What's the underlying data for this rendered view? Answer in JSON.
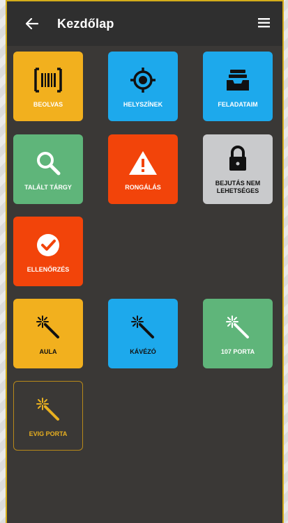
{
  "header": {
    "title": "Kezdőlap"
  },
  "colors": {
    "yellow": "#F2B01E",
    "blue": "#1DA9EC",
    "green": "#5FB57A",
    "red": "#F2440A",
    "grey": "#C9CACC",
    "outline": "#B8891A",
    "background": "#3A3836",
    "appbar": "#2F2F2F"
  },
  "tiles": [
    {
      "label": "BEOLVAS",
      "icon": "barcode-icon",
      "color": "yellow"
    },
    {
      "label": "HELYSZÍNEK",
      "icon": "location-target-icon",
      "color": "blue"
    },
    {
      "label": "FELADATAIM",
      "icon": "inbox-tray-icon",
      "color": "blue"
    },
    {
      "label": "TALÁLT TÁRGY",
      "icon": "search-icon",
      "color": "green"
    },
    {
      "label": "RONGÁLÁS",
      "icon": "warning-icon",
      "color": "red"
    },
    {
      "label": "BEJUTÁS NEM LEHETSÉGES",
      "icon": "lock-icon",
      "color": "grey"
    },
    {
      "label": "ELLENŐRZÉS",
      "icon": "check-circle-icon",
      "color": "red"
    },
    {
      "label": "AULA",
      "icon": "magic-wand-icon",
      "color": "yellow"
    },
    {
      "label": "KÁVÉZÓ",
      "icon": "magic-wand-icon",
      "color": "blue"
    },
    {
      "label": "107 PORTA",
      "icon": "magic-wand-icon",
      "color": "green"
    },
    {
      "label": "EVIG PORTA",
      "icon": "magic-wand-icon",
      "color": "outline"
    }
  ]
}
